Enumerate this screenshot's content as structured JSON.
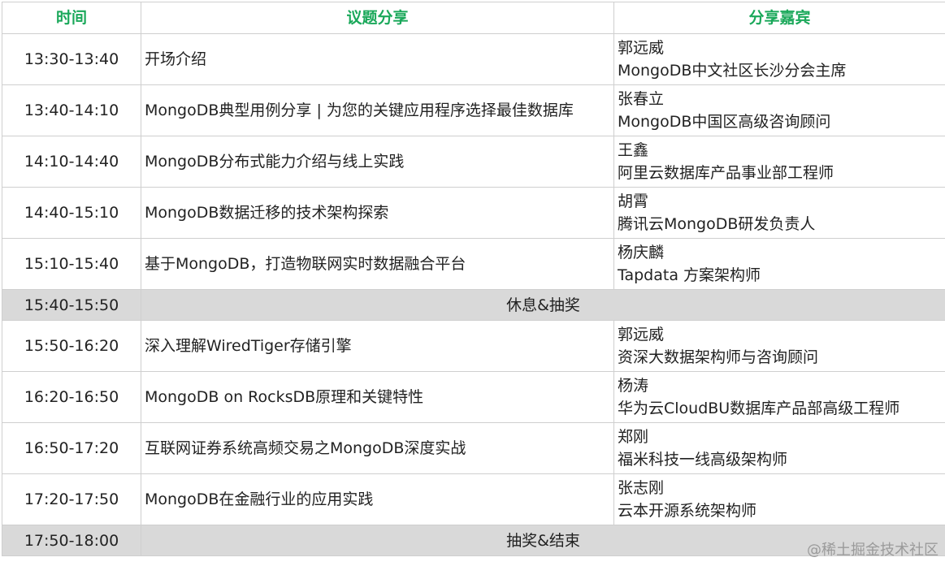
{
  "header": {
    "time": "时间",
    "topic": "议题分享",
    "speaker": "分享嘉宾"
  },
  "sessions": [
    {
      "time": "13:30-13:40",
      "topic": "开场介绍",
      "speaker_name": "郭远威",
      "speaker_title": "MongoDB中文社区长沙分会主席"
    },
    {
      "time": "13:40-14:10",
      "topic": "MongoDB典型用例分享 | 为您的关键应用程序选择最佳数据库",
      "speaker_name": "张春立",
      "speaker_title": "MongoDB中国区高级咨询顾问"
    },
    {
      "time": "14:10-14:40",
      "topic": "MongoDB分布式能力介绍与线上实践",
      "speaker_name": "王鑫",
      "speaker_title": "阿里云数据库产品事业部工程师"
    },
    {
      "time": "14:40-15:10",
      "topic": "MongoDB数据迁移的技术架构探索",
      "speaker_name": "胡霄",
      "speaker_title": "腾讯云MongoDB研发负责人"
    },
    {
      "time": "15:10-15:40",
      "topic": "基于MongoDB，打造物联网实时数据融合平台",
      "speaker_name": "杨庆麟",
      "speaker_title": "Tapdata 方案架构师"
    }
  ],
  "break1": {
    "time": "15:40-15:50",
    "label": "休息&抽奖"
  },
  "sessions2": [
    {
      "time": "15:50-16:20",
      "topic": "深入理解WiredTiger存储引擎",
      "speaker_name": "郭远威",
      "speaker_title": "资深大数据架构师与咨询顾问"
    },
    {
      "time": "16:20-16:50",
      "topic": "MongoDB on RocksDB原理和关键特性",
      "speaker_name": "杨涛",
      "speaker_title": "华为云CloudBU数据库产品部高级工程师"
    },
    {
      "time": "16:50-17:20",
      "topic": "互联网证券系统高频交易之MongoDB深度实战",
      "speaker_name": "郑刚",
      "speaker_title": "福米科技一线高级架构师"
    },
    {
      "time": "17:20-17:50",
      "topic": "MongoDB在金融行业的应用实践",
      "speaker_name": "张志刚",
      "speaker_title": "云本开源系统架构师"
    }
  ],
  "break2": {
    "time": "17:50-18:00",
    "label": "抽奖&结束"
  },
  "watermark": "@稀土掘金技术社区"
}
